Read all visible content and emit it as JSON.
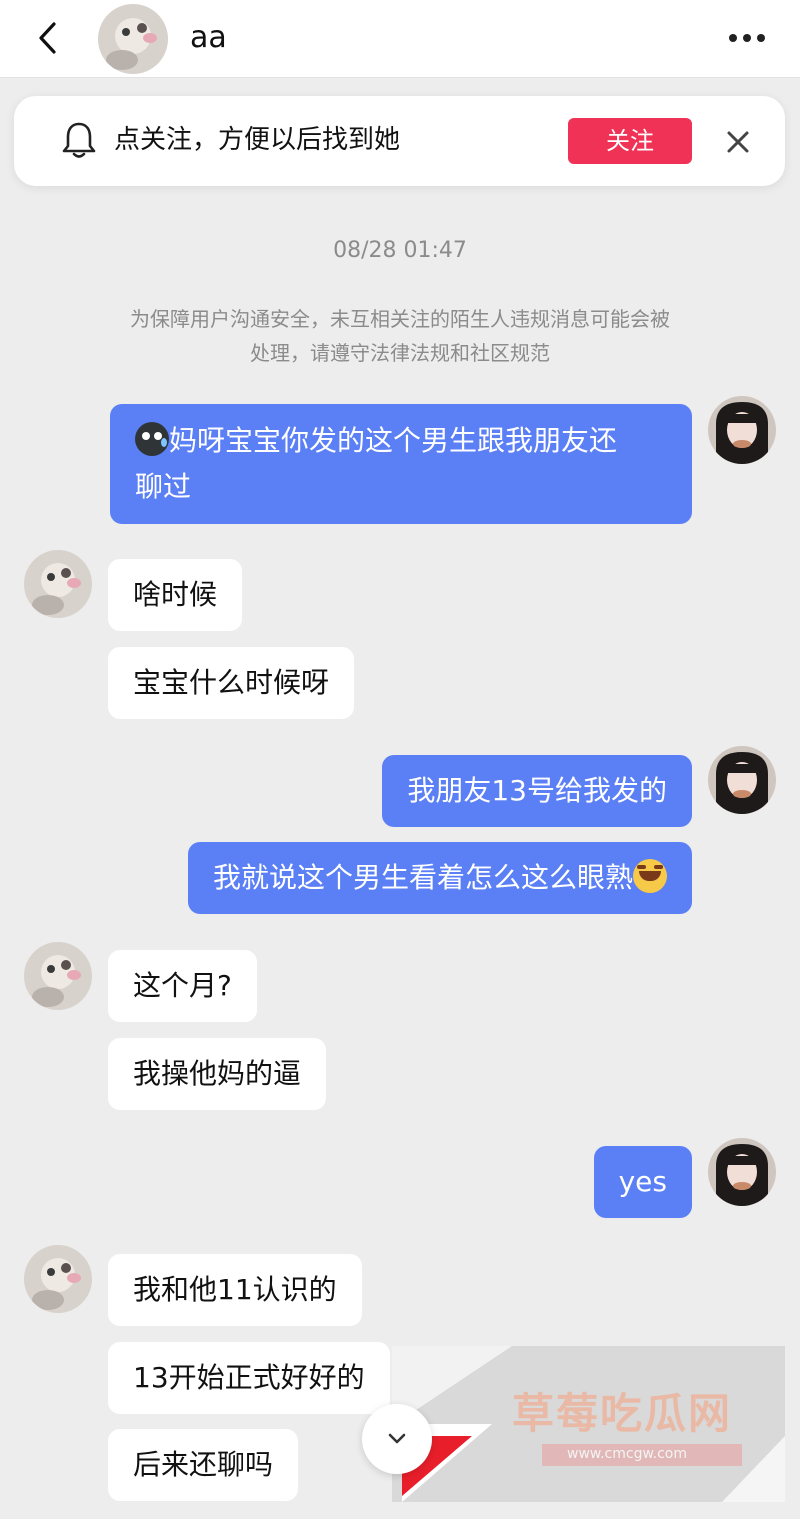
{
  "header": {
    "contact_name": "aa",
    "back_icon": "chevron-left-icon",
    "more_icon": "more-horizontal-icon"
  },
  "follow_banner": {
    "icon": "bell-icon",
    "text": "点关注，方便以后找到她",
    "button_label": "关注",
    "close_icon": "close-icon",
    "accent_color": "#ef3255"
  },
  "chat": {
    "timestamp": "08/28 01:47",
    "notice_line1": "为保障用户沟通安全，未互相关注的陌生人违规消息可能会被",
    "notice_line2": "处理，请遵守法律法规和社区规范",
    "bubble_color_me": "#5b7ff5",
    "bubble_color_other": "#ffffff",
    "messages": [
      {
        "from": "me",
        "emoji_before": "cold-sweat-emoji",
        "text_line1": "妈呀宝宝你发的这个男生跟我朋友还",
        "text_line2": "聊过"
      },
      {
        "from": "other",
        "text": "啥时候"
      },
      {
        "from": "other",
        "text": "宝宝什么时候呀"
      },
      {
        "from": "me",
        "text": "我朋友13号给我发的"
      },
      {
        "from": "me",
        "text": "我就说这个男生看着怎么这么眼熟",
        "emoji_after": "rolling-laughing-emoji"
      },
      {
        "from": "other",
        "text": "这个月?"
      },
      {
        "from": "other",
        "text": "我操他妈的逼"
      },
      {
        "from": "me",
        "text": "yes"
      },
      {
        "from": "other",
        "text": "我和他11认识的"
      },
      {
        "from": "other",
        "text": "13开始正式好好的"
      },
      {
        "from": "other",
        "text": "后来还聊吗"
      }
    ]
  },
  "watermark": {
    "title": "草莓吃瓜网",
    "url": "www.cmcgw.com"
  },
  "scroll_down_icon": "chevron-down-icon"
}
